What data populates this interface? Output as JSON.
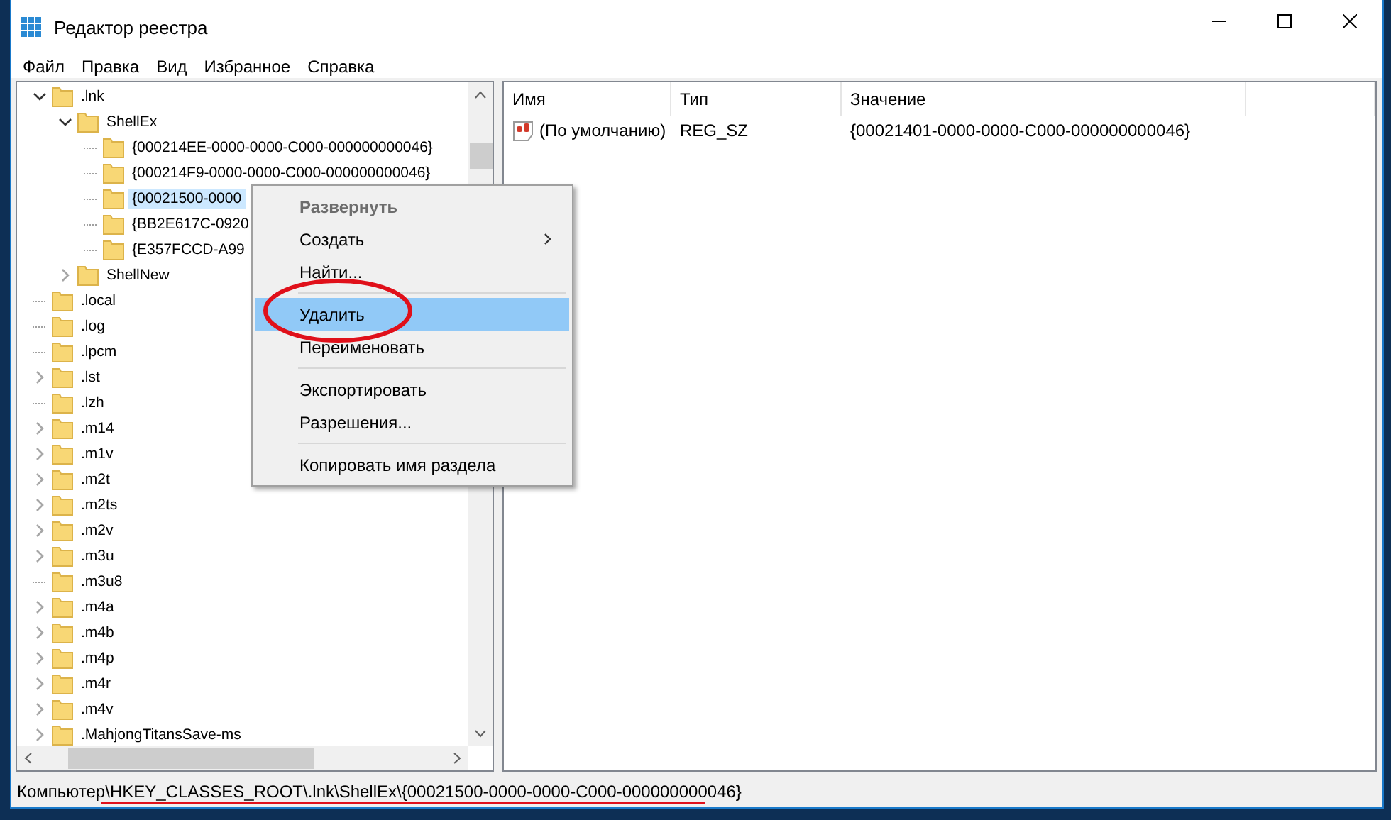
{
  "window": {
    "title": "Редактор реестра"
  },
  "menu": [
    "Файл",
    "Правка",
    "Вид",
    "Избранное",
    "Справка"
  ],
  "tree": [
    {
      "kind": "branch",
      "label": ".lnk",
      "expanded": true,
      "selected": false,
      "children": [
        {
          "kind": "branch",
          "label": "ShellEx",
          "expanded": true,
          "selected": false,
          "children": [
            {
              "kind": "leaf",
              "label": "{000214EE-0000-0000-C000-000000000046}",
              "selected": false
            },
            {
              "kind": "leaf",
              "label": "{000214F9-0000-0000-C000-000000000046}",
              "selected": false
            },
            {
              "kind": "leaf",
              "label": "{00021500-0000",
              "selected": true
            },
            {
              "kind": "leaf",
              "label": "{BB2E617C-0920",
              "selected": false
            },
            {
              "kind": "leaf",
              "label": "{E357FCCD-A99",
              "selected": false
            }
          ]
        },
        {
          "kind": "branch",
          "label": "ShellNew",
          "expanded": false,
          "selected": false
        }
      ]
    },
    {
      "kind": "leaf",
      "label": ".local",
      "selected": false
    },
    {
      "kind": "leaf",
      "label": ".log",
      "selected": false
    },
    {
      "kind": "leaf",
      "label": ".lpcm",
      "selected": false
    },
    {
      "kind": "branch",
      "label": ".lst",
      "expanded": false,
      "selected": false
    },
    {
      "kind": "leaf",
      "label": ".lzh",
      "selected": false
    },
    {
      "kind": "branch",
      "label": ".m14",
      "expanded": false,
      "selected": false
    },
    {
      "kind": "branch",
      "label": ".m1v",
      "expanded": false,
      "selected": false
    },
    {
      "kind": "branch",
      "label": ".m2t",
      "expanded": false,
      "selected": false
    },
    {
      "kind": "branch",
      "label": ".m2ts",
      "expanded": false,
      "selected": false
    },
    {
      "kind": "branch",
      "label": ".m2v",
      "expanded": false,
      "selected": false
    },
    {
      "kind": "branch",
      "label": ".m3u",
      "expanded": false,
      "selected": false
    },
    {
      "kind": "leaf",
      "label": ".m3u8",
      "selected": false
    },
    {
      "kind": "branch",
      "label": ".m4a",
      "expanded": false,
      "selected": false
    },
    {
      "kind": "branch",
      "label": ".m4b",
      "expanded": false,
      "selected": false
    },
    {
      "kind": "branch",
      "label": ".m4p",
      "expanded": false,
      "selected": false
    },
    {
      "kind": "branch",
      "label": ".m4r",
      "expanded": false,
      "selected": false
    },
    {
      "kind": "branch",
      "label": ".m4v",
      "expanded": false,
      "selected": false
    },
    {
      "kind": "branch",
      "label": ".MahjongTitansSave-ms",
      "expanded": false,
      "selected": false
    }
  ],
  "values": {
    "columns": [
      "Имя",
      "Тип",
      "Значение"
    ],
    "rows": [
      {
        "name": "(По умолчанию)",
        "type": "REG_SZ",
        "value": "{00021401-0000-0000-C000-000000000046}"
      }
    ]
  },
  "context_menu": [
    {
      "kind": "item",
      "label": "Развернуть",
      "bold": true,
      "disabled": true,
      "submenu": false,
      "selected": false
    },
    {
      "kind": "item",
      "label": "Создать",
      "bold": false,
      "disabled": false,
      "submenu": true,
      "selected": false
    },
    {
      "kind": "item",
      "label": "Найти...",
      "bold": false,
      "disabled": false,
      "submenu": false,
      "selected": false
    },
    {
      "kind": "separator"
    },
    {
      "kind": "item",
      "label": "Удалить",
      "bold": false,
      "disabled": false,
      "submenu": false,
      "selected": true
    },
    {
      "kind": "item",
      "label": "Переименовать",
      "bold": false,
      "disabled": false,
      "submenu": false,
      "selected": false
    },
    {
      "kind": "separator"
    },
    {
      "kind": "item",
      "label": "Экспортировать",
      "bold": false,
      "disabled": false,
      "submenu": false,
      "selected": false
    },
    {
      "kind": "item",
      "label": "Разрешения...",
      "bold": false,
      "disabled": false,
      "submenu": false,
      "selected": false
    },
    {
      "kind": "separator"
    },
    {
      "kind": "item",
      "label": "Копировать имя раздела",
      "bold": false,
      "disabled": false,
      "submenu": false,
      "selected": false
    }
  ],
  "status_bar": "Компьютер\\HKEY_CLASSES_ROOT\\.lnk\\ShellEx\\{00021500-0000-0000-C000-000000000046}"
}
